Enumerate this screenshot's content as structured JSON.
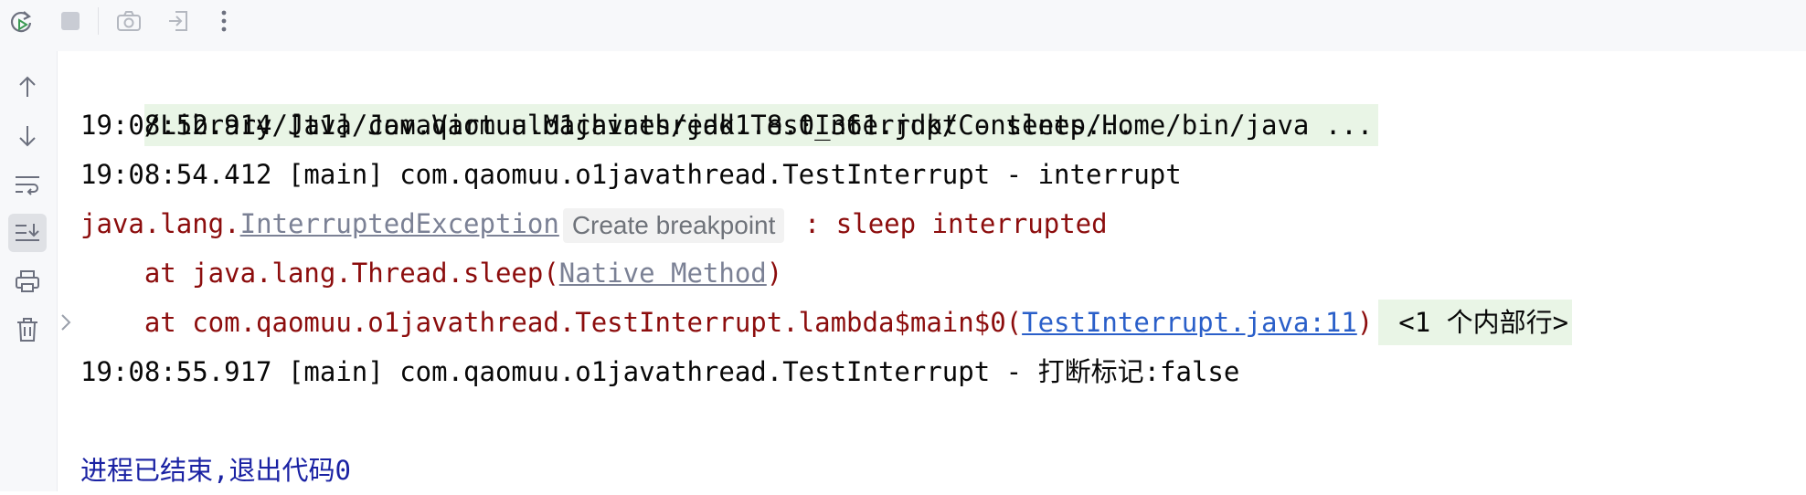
{
  "toolbar": {
    "buttons": [
      {
        "name": "rerun-icon"
      },
      {
        "name": "stop-icon"
      },
      {
        "name": "camera-icon"
      },
      {
        "name": "exit-icon"
      },
      {
        "name": "more-icon"
      }
    ]
  },
  "sidebar": {
    "buttons": [
      "up-arrow-icon",
      "down-arrow-icon",
      "soft-wrap-icon",
      "scroll-to-end-icon",
      "print-icon",
      "trash-icon"
    ]
  },
  "console": {
    "command_line": "/Library/Java/JavaVirtualMachines/jdk1.8.0_361.jdk/Contents/Home/bin/java ...",
    "log1": "19:08:52.914 [t1] com.qaomuu.o1javathread.TestInterrupt - sleep...",
    "log2": "19:08:54.412 [main] com.qaomuu.o1javathread.TestInterrupt - interrupt",
    "exception_prefix": "java.lang.",
    "exception_class": "InterruptedException",
    "breakpoint_hint": "Create breakpoint",
    "exception_message": " : sleep interrupted",
    "frame1_prefix": "    at java.lang.Thread.sleep(",
    "frame1_link": "Native Method",
    "frame1_suffix": ")",
    "frame2_prefix": "    at com.qaomuu.o1javathread.TestInterrupt.lambda$main$0(",
    "frame2_link": "TestInterrupt.java:11",
    "frame2_suffix": ")",
    "internal_frames": "<1 个内部行>",
    "log3": "19:08:55.917 [main] com.qaomuu.o1javathread.TestInterrupt - 打断标记:false",
    "exit_message": "进程已结束,退出代码0"
  },
  "colors": {
    "error": "#8c0d0d",
    "link": "#2a5fc9",
    "exit": "#1a22a3",
    "command_bg": "#e9f5e6"
  }
}
